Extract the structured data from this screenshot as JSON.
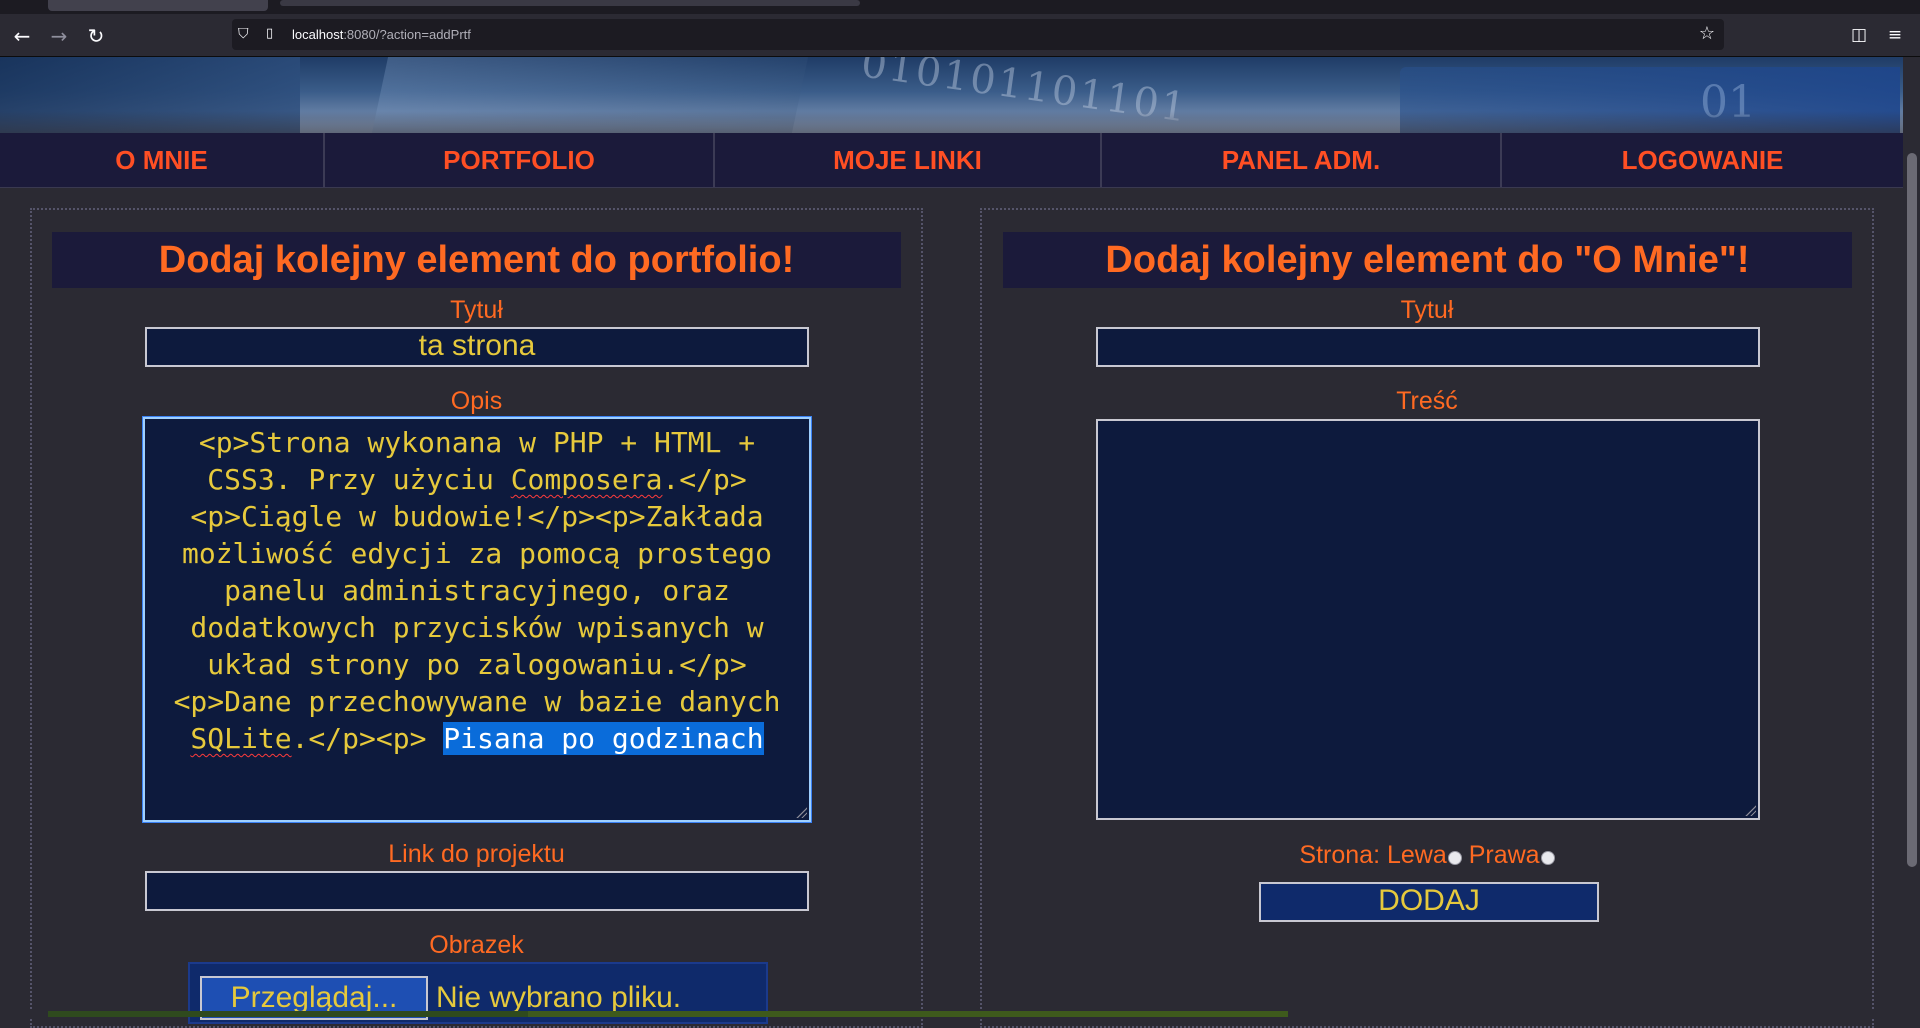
{
  "browser": {
    "url_host": "localhost",
    "url_rest": ":8080/?action=addPrtf",
    "icons": {
      "back": "back-arrow-icon",
      "forward": "forward-arrow-icon",
      "reload": "reload-icon",
      "shield": "tracking-shield-icon",
      "page": "page-icon",
      "bookmark": "star-icon",
      "pocket": "pocket-icon",
      "menu": "hamburger-menu-icon"
    }
  },
  "menu": {
    "items": [
      {
        "label": "O MNIE"
      },
      {
        "label": "PORTFOLIO"
      },
      {
        "label": "MOJE LINKI"
      },
      {
        "label": "PANEL ADM."
      },
      {
        "label": "LOGOWANIE"
      }
    ]
  },
  "left_form": {
    "title": "Dodaj kolejny element do portfolio!",
    "title_label": "Tytuł",
    "title_value": "ta strona",
    "desc_label": "Opis",
    "desc_part1": "<p>Strona wykonana w PHP + HTML + CSS3. Przy użyciu ",
    "desc_sq1": "Composera",
    "desc_part2": ".</p><p>Ciągle w budowie!</p><p>Zakłada możliwość edycji za pomocą prostego panelu administracyjnego, oraz dodatkowych przycisków wpisanych w układ strony po zalogowaniu.</p><p>Dane przechowywane w bazie danych ",
    "desc_sq2": "SQLite",
    "desc_part3": ".</p><p> ",
    "desc_selected": "Pisana po godzinach",
    "link_label": "Link do projektu",
    "link_value": "",
    "image_label": "Obrazek",
    "browse_button": "Przeglądaj...",
    "no_file": "Nie wybrano pliku."
  },
  "right_form": {
    "title": "Dodaj kolejny element do \"O Mnie\"!",
    "title_label": "Tytuł",
    "title_value": "",
    "content_label": "Treść",
    "content_value": "",
    "side_label": "Strona: ",
    "side_left": "Lewa",
    "side_right": "Prawa",
    "submit": "DODAJ"
  },
  "colors": {
    "accent": "#ff6a22",
    "menu_text": "#ff4f24",
    "field_bg": "#0d1a3d",
    "field_text": "#e6c93c",
    "page_bg": "#2b2a33"
  }
}
